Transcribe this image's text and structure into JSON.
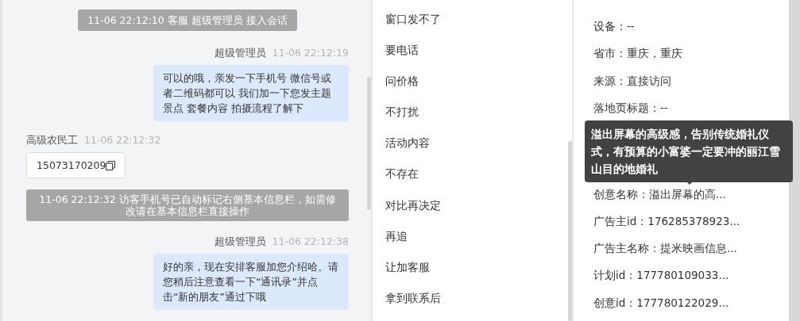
{
  "chat": {
    "messages": [
      {
        "kind": "system",
        "text": "11-06 22:12:10 客服 超级管理员 接入会话"
      },
      {
        "kind": "outgoing",
        "sender": "超级管理员",
        "time": "11-06 22:12:19",
        "text": "可以的哦，亲发一下手机号 微信号或者二维码都可以 我们加一下您发主题景点 套餐内容 拍摄流程了解下"
      },
      {
        "kind": "incoming",
        "sender": "高级农民工",
        "time": "11-06 22:12:32",
        "card": "15073170209"
      },
      {
        "kind": "system",
        "text": "11-06 22:12:32 访客手机号已自动标记右侧基本信息栏，如需修改请在基本信息栏直接操作"
      },
      {
        "kind": "outgoing",
        "sender": "超级管理员",
        "time": "11-06 22:12:38",
        "text": "好的亲，现在安排客服加您介绍哈。请您稍后注意查看一下“通讯录”并点击“新的朋友”通过下哦"
      }
    ]
  },
  "quick_replies": [
    "窗口发不了",
    "要电话",
    "问价格",
    "不打扰",
    "活动内容",
    "不存在",
    "对比再决定",
    "再追",
    "让加客服",
    "拿到联系后"
  ],
  "info": {
    "rows_above": [
      "设备：--",
      "省市：重庆，重庆",
      "来源：直接访问",
      "落地页标题：--"
    ],
    "tooltip": "溢出屏幕的高级感，告别传统婚礼仪式，有预算的小富婆一定要冲的丽江雪山目的地婚礼",
    "rows_below": [
      "创意名称：溢出屏幕的高...",
      "广告主id：176285378923...",
      "广告主名称：提米映画信息...",
      "计划id：177780109033...",
      "创意id：177780122029..."
    ]
  }
}
